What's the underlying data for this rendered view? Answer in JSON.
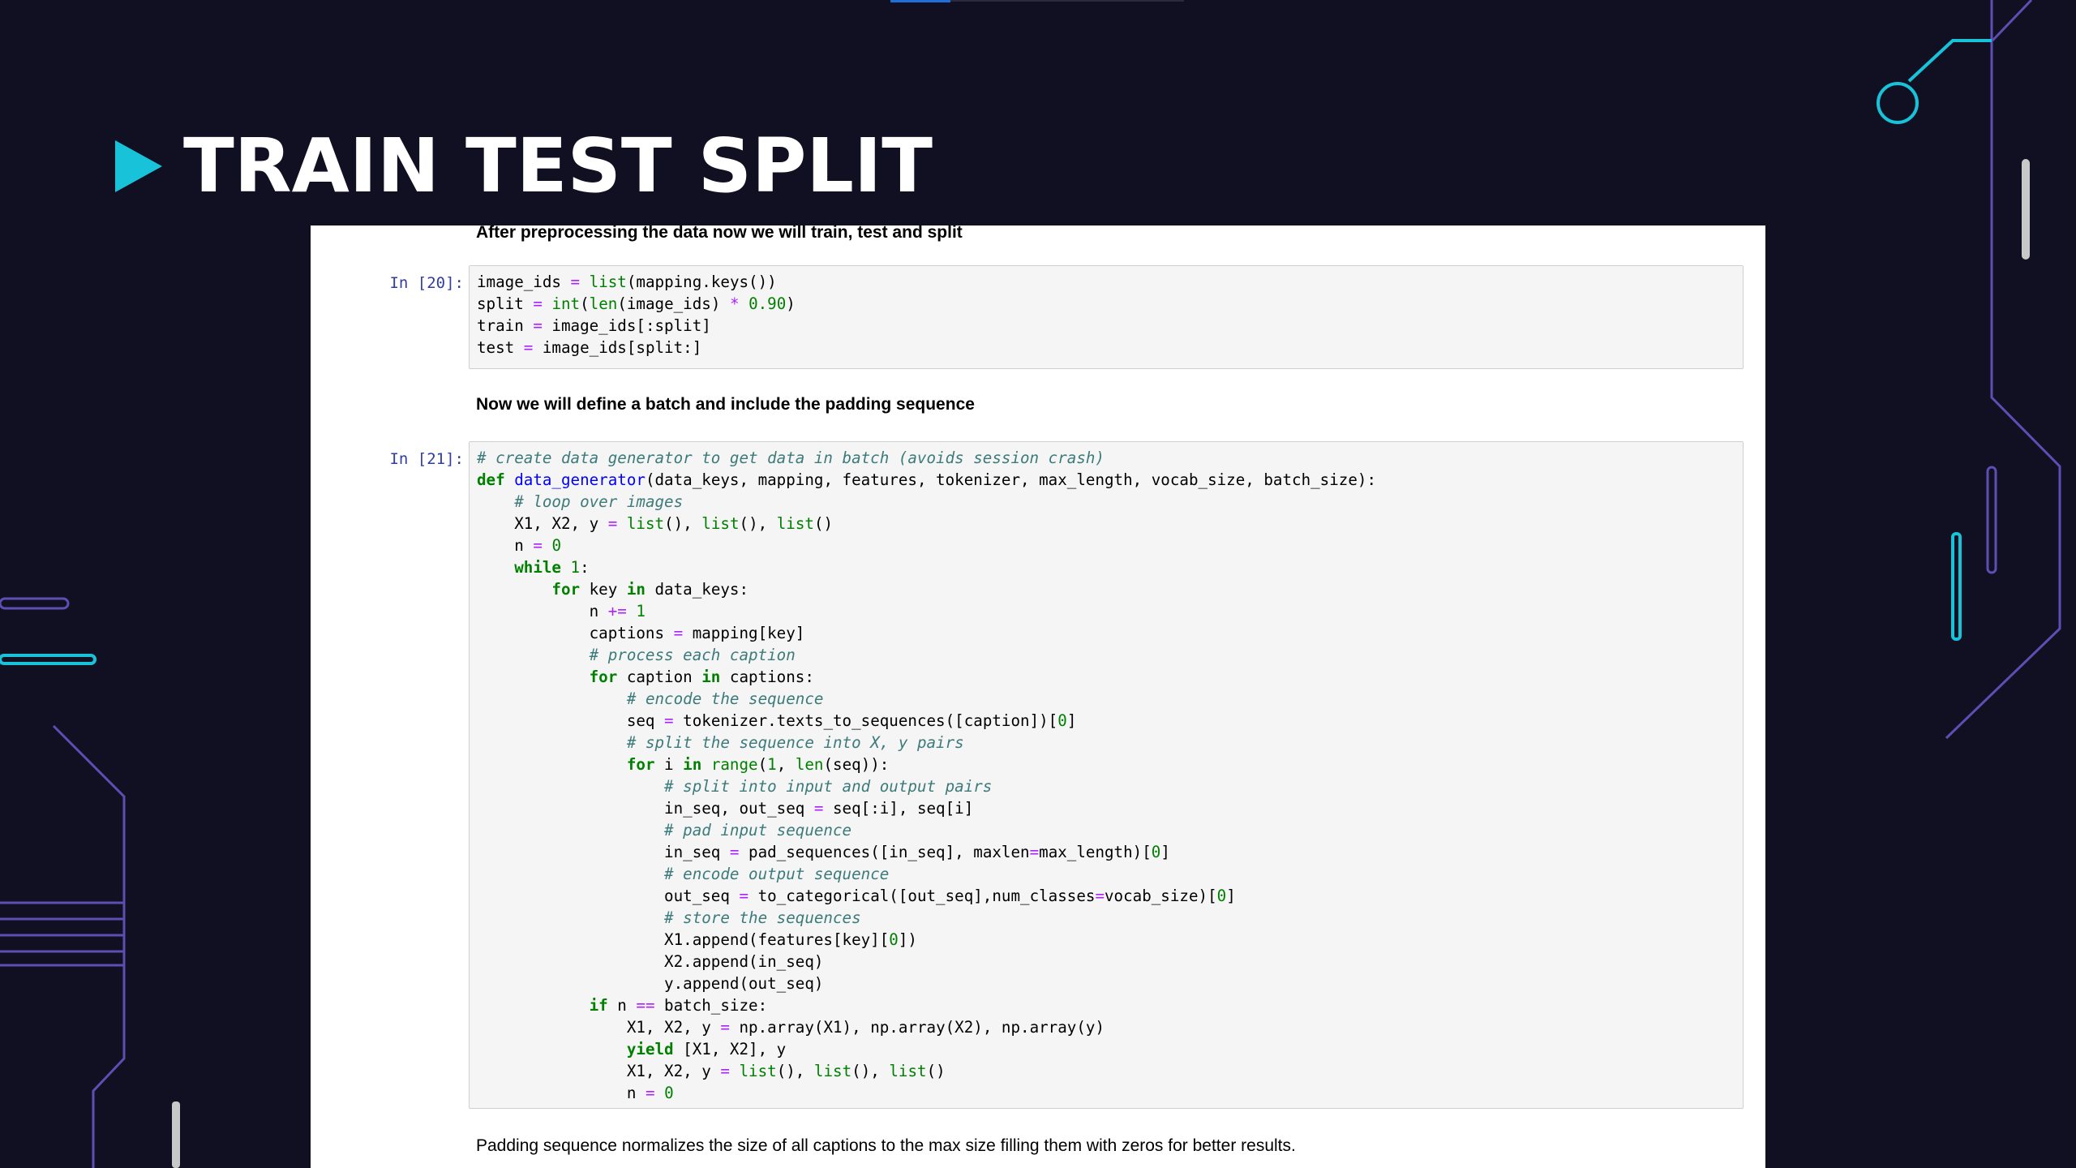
{
  "slide": {
    "title": "TRAIN TEST SPLIT",
    "accent_color": "#18c2d8",
    "background_color": "#110f22",
    "deco_line_color": "#5b4fb3"
  },
  "notebook": {
    "markdown1": "After preprocessing the data now we will train, test and split",
    "cell1": {
      "prompt": "In [20]:",
      "lines": [
        "image_ids = list(mapping.keys())",
        "split = int(len(image_ids) * 0.90)",
        "train = image_ids[:split]",
        "test = image_ids[split:]"
      ]
    },
    "markdown2": "Now we will define a batch and include the padding sequence",
    "cell2": {
      "prompt": "In [21]:",
      "lines": [
        "# create data generator to get data in batch (avoids session crash)",
        "def data_generator(data_keys, mapping, features, tokenizer, max_length, vocab_size, batch_size):",
        "    # loop over images",
        "    X1, X2, y = list(), list(), list()",
        "    n = 0",
        "    while 1:",
        "        for key in data_keys:",
        "            n += 1",
        "            captions = mapping[key]",
        "            # process each caption",
        "            for caption in captions:",
        "                # encode the sequence",
        "                seq = tokenizer.texts_to_sequences([caption])[0]",
        "                # split the sequence into X, y pairs",
        "                for i in range(1, len(seq)):",
        "                    # split into input and output pairs",
        "                    in_seq, out_seq = seq[:i], seq[i]",
        "                    # pad input sequence",
        "                    in_seq = pad_sequences([in_seq], maxlen=max_length)[0]",
        "                    # encode output sequence",
        "                    out_seq = to_categorical([out_seq],num_classes=vocab_size)[0]",
        "                    # store the sequences",
        "                    X1.append(features[key][0])",
        "                    X2.append(in_seq)",
        "                    y.append(out_seq)",
        "            if n == batch_size:",
        "                X1, X2, y = np.array(X1), np.array(X2), np.array(y)",
        "                yield [X1, X2], y",
        "                X1, X2, y = list(), list(), list()",
        "                n = 0"
      ]
    },
    "markdown3": "Padding sequence normalizes the size of all captions to the max size filling them with zeros for better results."
  }
}
